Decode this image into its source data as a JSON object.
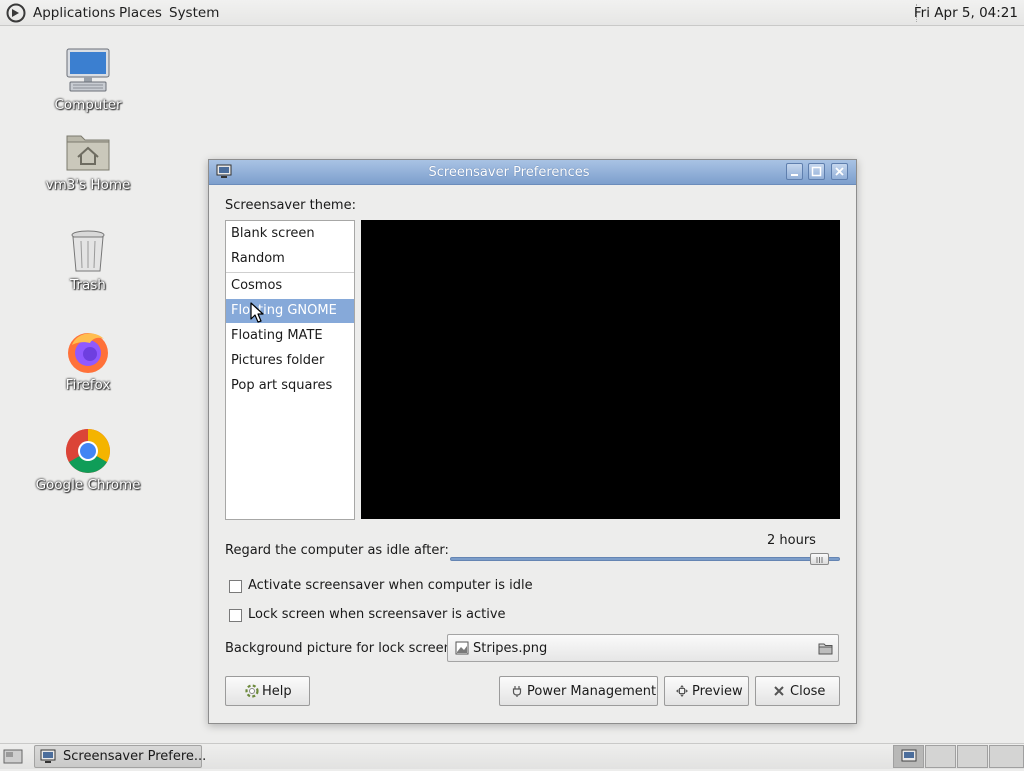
{
  "top_panel": {
    "menus": [
      "Applications",
      "Places",
      "System"
    ],
    "clock": "Fri Apr 5, 04:21"
  },
  "desktop": {
    "icons": [
      {
        "label": "Computer",
        "icon": "computer-icon"
      },
      {
        "label": "vm3's Home",
        "icon": "home-folder-icon"
      },
      {
        "label": "Trash",
        "icon": "trash-icon"
      },
      {
        "label": "Firefox",
        "icon": "firefox-icon"
      },
      {
        "label": "Google Chrome",
        "icon": "chrome-icon"
      }
    ]
  },
  "window": {
    "title": "Screensaver Preferences",
    "theme_label": "Screensaver theme:",
    "themes": [
      "Blank screen",
      "Random",
      "Cosmos",
      "Floating GNOME",
      "Floating MATE",
      "Pictures folder",
      "Pop art squares"
    ],
    "selected_theme": "Floating GNOME",
    "idle_label": "Regard the computer as idle after:",
    "idle_value": "2 hours",
    "idle_slider_fraction": 0.97,
    "activate_label": "Activate screensaver when computer is idle",
    "activate_checked": false,
    "lock_label": "Lock screen when screensaver is active",
    "lock_checked": false,
    "background_label": "Background picture for lock screen:",
    "background_file": "Stripes.png",
    "buttons": {
      "help": "Help",
      "power": "Power Management",
      "preview": "Preview",
      "close": "Close"
    }
  },
  "taskbar": {
    "task_label": "Screensaver Prefere..."
  },
  "colors": {
    "titlebar": "#7d9fcd",
    "selection": "#86a9d9",
    "preview_bg": "#000000"
  }
}
